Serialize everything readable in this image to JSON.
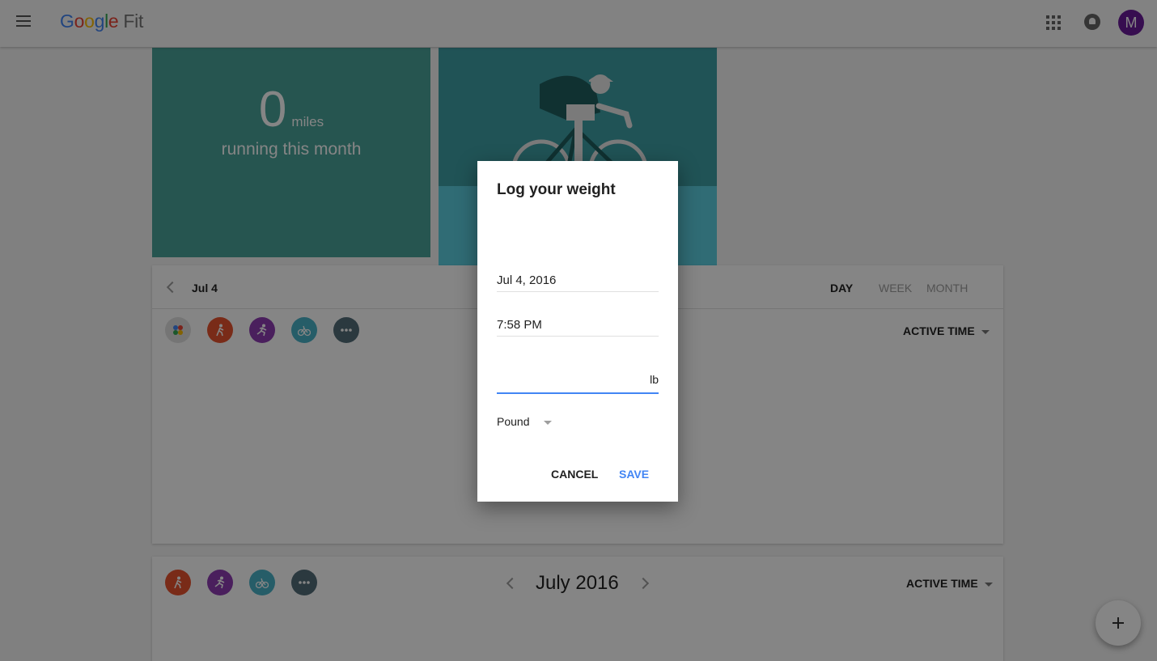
{
  "app": {
    "logo_letters": [
      "G",
      "o",
      "o",
      "g",
      "l",
      "e"
    ],
    "product": "Fit",
    "avatar_initial": "M"
  },
  "header_icons": [
    "menu-icon",
    "apps-grid-icon",
    "notifications-bell-icon"
  ],
  "running_card": {
    "value": "0",
    "unit": "miles",
    "label": "running this month"
  },
  "day_panel": {
    "date": "Jul 4",
    "periods": [
      "DAY",
      "WEEK",
      "MONTH"
    ],
    "active_period": "DAY",
    "metric": "ACTIVE TIME"
  },
  "activity_icons": [
    "all-activities-icon",
    "walking-icon",
    "running-icon",
    "biking-icon",
    "more-icon"
  ],
  "month_panel": {
    "title": "July 2016",
    "metric": "ACTIVE TIME"
  },
  "dialog": {
    "title": "Log your weight",
    "date": "Jul 4, 2016",
    "time": "7:58 PM",
    "weight_value": "",
    "weight_unit_suffix": "lb",
    "unit_select": "Pound",
    "cancel": "CANCEL",
    "save": "SAVE"
  },
  "colors": {
    "walking": "#e8532e",
    "running": "#8e3cb2",
    "biking": "#49b3c8",
    "more": "#546e7a",
    "accent": "#4285f4"
  }
}
